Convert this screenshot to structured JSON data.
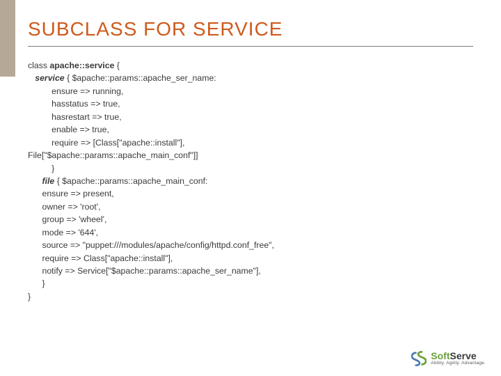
{
  "title": "SUBCLASS FOR SERVICE",
  "code": {
    "l1": "class ",
    "l1b": "apache::service",
    "l1c": " {",
    "l2a": "   ",
    "l2b": "service",
    "l2c": " { $apache::params::apache_ser_name:",
    "l3": "          ensure => running,",
    "l4": "          hasstatus => true,",
    "l5": "          hasrestart => true,",
    "l6": "          enable => true,",
    "l7": "          require => [Class[\"apache::install\"],",
    "l8": "File[\"$apache::params::apache_main_conf\"]]",
    "l9": "          }",
    "l10a": "      ",
    "l10b": "file",
    "l10c": " { $apache::params::apache_main_conf:",
    "l11": "      ensure => present,",
    "l12": "      owner => 'root',",
    "l13": "      group => 'wheel',",
    "l14": "      mode => '644',",
    "l15": "      source => \"puppet:///modules/apache/config/httpd.conf_free\",",
    "l16": "      require => Class[\"apache::install\"],",
    "l17": "      notify => Service[\"$apache::params::apache_ser_name\"],",
    "l18": "      }",
    "l19": "}"
  },
  "brand": {
    "name1": "Soft",
    "name2": "Serve",
    "tagline": "Ability. Agility. Advantage."
  }
}
